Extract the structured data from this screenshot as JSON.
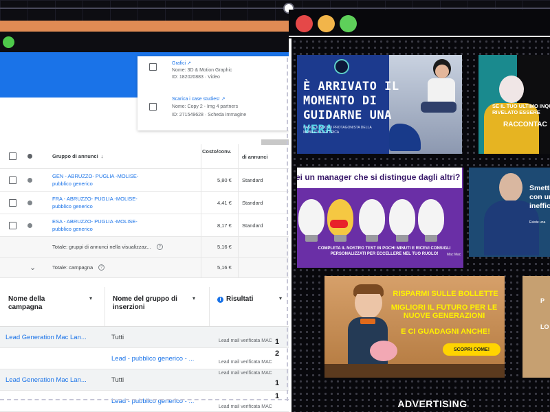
{
  "left_window": {
    "popup": {
      "items": [
        {
          "title": "Grafici ↗",
          "name": "Nome: 3D & Motion Graphic",
          "id": "ID: 182020883 · Video"
        },
        {
          "title": "Scarica i case studies! ↗",
          "name": "Nome: Copy 2 - Img 4 partners",
          "id": "ID: 271549628 · Scheda immagine"
        }
      ]
    },
    "ad_groups_table": {
      "headers": {
        "ad_group": "Gruppo di annunci",
        "cost": "Costo/conv.",
        "bid": "di annunci"
      },
      "rows": [
        {
          "name_line1": "GEN - ABRUZZO- PUGLIA -MOLISE-",
          "name_line2": "pubblico generico",
          "cost": "5,80 €",
          "type": "Standard"
        },
        {
          "name_line1": "FRA - ABRUZZO- PUGLIA -MOLISE-",
          "name_line2": "pubblico generico",
          "cost": "4,41 €",
          "type": "Standard"
        },
        {
          "name_line1": "ESA - ABRUZZO- PUGLIA -MOLISE-",
          "name_line2": "pubblico generico",
          "cost": "8,17 €",
          "type": "Standard"
        }
      ],
      "totals": [
        {
          "label": "Totale: gruppi di annunci nella visualizzaz...",
          "value": "5,16 €"
        },
        {
          "label": "Totale: campagna",
          "value": "5,16 €"
        }
      ]
    },
    "results_table": {
      "headers": {
        "campaign": "Nome della campagna",
        "ad_group": "Nome del gruppo di inserzioni",
        "results": "Risultati"
      },
      "rows": [
        {
          "campaign": "Lead Generation Mac Lan...",
          "group": "Tutti",
          "group_link": false,
          "result_label": "Lead mail verificata MAC",
          "result_value": "1"
        },
        {
          "campaign": "",
          "group": "Lead - pubblico generico - ...",
          "group_link": true,
          "result_label": "Lead mail verificata MAC",
          "result_value": "2"
        },
        {
          "campaign": "Lead Generation Mac Lan...",
          "group": "Tutti",
          "group_link": false,
          "result_label": "Lead mail verificata MAC",
          "result_value": "1"
        },
        {
          "campaign": "",
          "group": "Lead - pubblico generico - ...",
          "group_link": true,
          "result_label": "Lead mail verificata MAC",
          "result_value": "1"
        }
      ]
    }
  },
  "right_window": {
    "traffic_lights": {
      "close": "#e54848",
      "minimize": "#f2b54a",
      "maximize": "#5ed05a"
    },
    "ads": {
      "mobility": {
        "title_l1": "È ARRIVATO IL",
        "title_l2": "MOMENTO DI",
        "title_l3": "GUIDARNE UNA",
        "title_hl": "VERA",
        "subtitle": "NASCE IL NUOVO PROTAGONISTA DELLA MOBILITÀ ELETTRICA"
      },
      "injury": {
        "line": "SE IL TUO ULTIMO INQU... SI È RIVELATO ESSERE",
        "cta": "RACCONTAC"
      },
      "manager": {
        "question": "ei un manager che si distingue dagli altri?",
        "body": "COMPLETA IL NOSTRO TEST IN POCHI MINUTI E RICEVI CONSIGLI PERSONALIZZATI PER ECCELLERE NEL TUO RUOLO!",
        "signature": "Mac Mac"
      },
      "businessman": {
        "line1": "Smetti",
        "line2": "con un",
        "line3": "ineffic",
        "small": "Esiste una"
      },
      "bollette": {
        "headline": "RISPARMI SULLE BOLLETTE",
        "line2": "MIGLIORI IL FUTURO PER LE NUOVE GENERAZIONI",
        "line3": "E CI GUADAGNI ANCHE!",
        "button": "SCOPRI COME!"
      },
      "partial": {
        "line1": "LO",
        "line2": "P"
      }
    },
    "section_label": "ADVERTISING"
  }
}
